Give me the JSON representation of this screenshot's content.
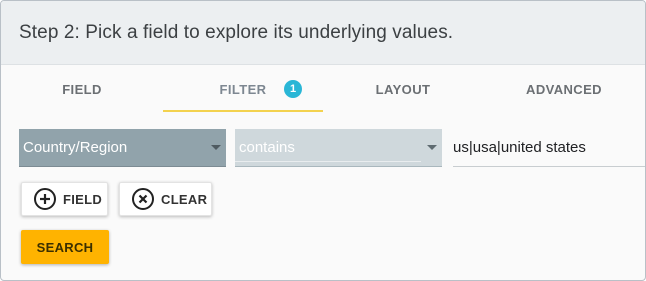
{
  "header": {
    "title": "Step 2: Pick a field to explore its underlying values."
  },
  "tabs": [
    {
      "label": "FIELD",
      "active": false
    },
    {
      "label": "FILTER",
      "active": true,
      "badge": "1"
    },
    {
      "label": "LAYOUT",
      "active": false
    },
    {
      "label": "ADVANCED",
      "active": false
    }
  ],
  "filter": {
    "field_select": {
      "value": "Country/Region"
    },
    "operator_select": {
      "value": "contains"
    },
    "value_input": {
      "value": "us|usa|united states"
    }
  },
  "buttons": {
    "add_field_label": "FIELD",
    "clear_label": "CLEAR",
    "search_label": "SEARCH"
  },
  "icons": {
    "add": "add-circle-icon",
    "clear": "cancel-circle-icon",
    "dropdown": "caret-down-icon"
  },
  "colors": {
    "tab_indicator": "#f3d24f",
    "badge": "#29b6d6",
    "search_button": "#ffb300",
    "field_select_bg": "#91a3ab",
    "operator_select_bg": "#cfd8dc"
  }
}
